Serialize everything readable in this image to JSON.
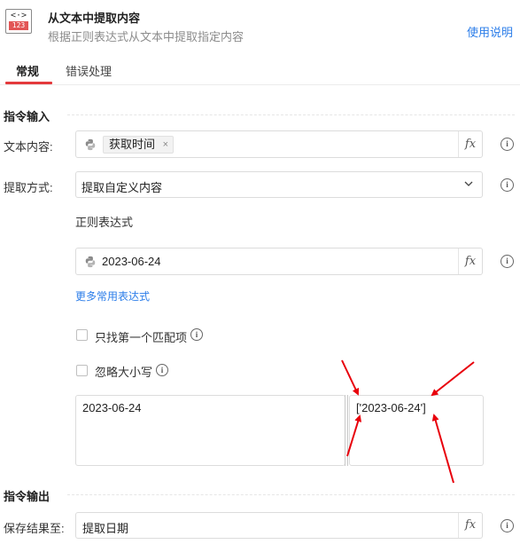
{
  "header": {
    "icon_code": "<·>",
    "icon_number": "123",
    "title": "从文本中提取内容",
    "subtitle": "根据正则表达式从文本中提取指定内容",
    "help_link": "使用说明"
  },
  "tabs": [
    {
      "label": "常规",
      "active": true
    },
    {
      "label": "错误处理",
      "active": false
    }
  ],
  "input_section": {
    "title": "指令输入",
    "text_content": {
      "label": "文本内容:",
      "variable_tag": "获取时间"
    },
    "extract_method": {
      "label": "提取方式:",
      "value": "提取自定义内容"
    },
    "regex": {
      "label": "正则表达式",
      "value": "2023-06-24"
    },
    "more_regex_link": "更多常用表达式",
    "checkbox_first_match": {
      "label": "只找第一个匹配项",
      "checked": false
    },
    "checkbox_ignore_case": {
      "label": "忽略大小写",
      "checked": false
    },
    "test_input": "2023-06-24",
    "test_output": "['2023-06-24']"
  },
  "output_section": {
    "title": "指令输出",
    "save_to": {
      "label": "保存结果至:",
      "value": "提取日期"
    }
  },
  "icons": {
    "fx": "fx",
    "info": "i",
    "tag_close": "×"
  },
  "colors": {
    "accent_red": "#e4393c",
    "link_blue": "#2b7de9",
    "annotation_red": "#e8000b"
  }
}
